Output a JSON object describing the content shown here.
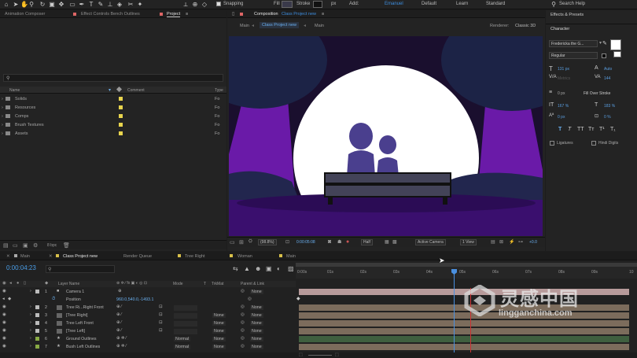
{
  "topbar": {
    "snapping": "Snapping",
    "fill": "Fill",
    "stroke": "Stroke",
    "px": "px",
    "add": "Add:",
    "workspaces": [
      "Emanuel",
      "Default",
      "Learn",
      "Standard"
    ],
    "search": "Search Help"
  },
  "left_tabs": [
    "Animation Composer",
    "Effect Controls Bench Outlines",
    "Project"
  ],
  "project": {
    "columns": [
      "Name",
      "Comment",
      "Type"
    ],
    "folders": [
      {
        "name": "Solids",
        "type": "Fo"
      },
      {
        "name": "Resources",
        "type": "Fo"
      },
      {
        "name": "Comps",
        "type": "Fo"
      },
      {
        "name": "Brush Textures",
        "type": "Fo"
      },
      {
        "name": "Assets",
        "type": "Fo"
      }
    ],
    "bpc": "8 bpc"
  },
  "comp": {
    "tab": "Composition",
    "name": "Class Project new",
    "breadcrumbs": [
      "Main",
      "Class Project new",
      "Main"
    ],
    "renderer_label": "Renderer:",
    "renderer": "Classic 3D",
    "zoom": "(98.8%)",
    "timecode": "0:00:05:08",
    "quality": "Half",
    "camera": "Active Camera",
    "view": "1 View",
    "offset": "+0.0"
  },
  "right": {
    "effects_presets": "Effects & Presets",
    "character": "Character",
    "font": "Fredericka the G...",
    "style": "Regular",
    "size": "131 px",
    "leading": "Auto",
    "kerning": "Metrics",
    "tracking": "144",
    "stroke_w": "0 px",
    "stroke_type": "Fill Over Stroke",
    "vscale": "167 %",
    "hscale": "183 %",
    "baseline": "0 px",
    "tsume": "0 %",
    "ligatures": "Ligatures",
    "hindi": "Hindi Digits"
  },
  "timeline": {
    "tabs": [
      "Main",
      "Class Project new",
      "Render Queue",
      "Tree Right",
      "Woman",
      "Main"
    ],
    "time": "0:00:04:23",
    "cols": [
      "Layer Name",
      "Mode",
      "T",
      "TrkMat",
      "Parent & Link"
    ],
    "ruler": [
      "0:00s",
      "01s",
      "02s",
      "03s",
      "04s",
      "05s",
      "06s",
      "07s",
      "08s",
      "09s",
      "10"
    ],
    "layers": [
      {
        "num": "1",
        "name": "Camera 1",
        "mode": "",
        "trk": "",
        "parent": "None"
      },
      {
        "num": "",
        "name": "Position",
        "mode": "",
        "trk": "",
        "parent": "",
        "value": "960.0,540.0,-1493.1"
      },
      {
        "num": "2",
        "name": "Tree Ri...Right Front",
        "mode": "",
        "trk": "",
        "parent": "None"
      },
      {
        "num": "3",
        "name": "[Tree Right]",
        "mode": "",
        "trk": "None",
        "parent": "None"
      },
      {
        "num": "4",
        "name": "Tree Left Front",
        "mode": "",
        "trk": "None",
        "parent": "None"
      },
      {
        "num": "5",
        "name": "[Tree Left]",
        "mode": "",
        "trk": "None",
        "parent": "None"
      },
      {
        "num": "6",
        "name": "Ground Outlines",
        "mode": "Normal",
        "trk": "None",
        "parent": "None"
      },
      {
        "num": "7",
        "name": "Bush Left Outlines",
        "mode": "Normal",
        "trk": "None",
        "parent": "None"
      }
    ]
  },
  "watermark": {
    "cn": "灵感中国",
    "url": "lingganchina.com"
  }
}
